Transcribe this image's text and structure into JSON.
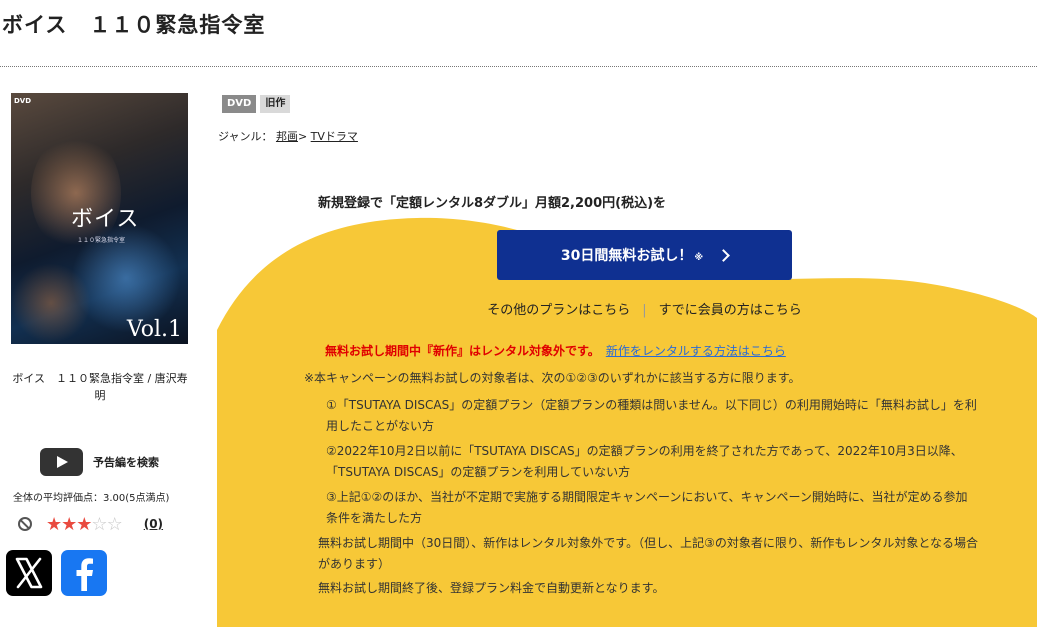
{
  "title": "ボイス　１１０緊急指令室",
  "cover": {
    "dvd_mark": "DVD",
    "title": "ボイス",
    "subtitle": "１１０緊急指令室",
    "vol": "Vol.1"
  },
  "product_name": "ボイス　１１０緊急指令室 / 唐沢寿明",
  "trailer_label": "予告編を検索",
  "average_rating_label": "全体の平均評価点：",
  "average_rating_value": "3.00(5点満点)",
  "rating": {
    "value": 3,
    "max": 5,
    "count_label": "(0)"
  },
  "badges": {
    "format": "DVD",
    "category": "旧作"
  },
  "genre": {
    "label": "ジャンル：",
    "items": [
      "邦画",
      "TVドラマ"
    ],
    "separator": ">"
  },
  "promo": {
    "headline": "新規登録で「定額レンタル8ダブル」月額2,200円(税込)を",
    "cta_label": "30日間無料お試し！",
    "cta_note": "※",
    "other_plans": "その他のプランはこちら",
    "member_link": "すでに会員の方はこちら"
  },
  "notice": {
    "warning": "無料お試し期間中『新作』はレンタル対象外です。",
    "link": "新作をレンタルする方法はこちら"
  },
  "terms": {
    "intro": "※本キャンペーンの無料お試しの対象者は、次の①②③のいずれかに該当する方に限ります。",
    "item1_line1": "①「TSUTAYA DISCAS」の定額プラン（定額プランの種類は問いません。以下同じ）の利用開始時に「無料お試し」を利",
    "item1_line2": "用したことがない方",
    "item2_line1": "②2022年10月2日以前に「TSUTAYA DISCAS」の定額プランの利用を終了された方であって、2022年10月3日以降、",
    "item2_line2": "「TSUTAYA DISCAS」の定額プランを利用していない方",
    "item3_line1": "③上記①②のほか、当社が不定期で実施する期間限定キャンペーンにおいて、キャンペーン開始時に、当社が定める参加",
    "item3_line2": "条件を満たした方",
    "note1_line1": "無料お試し期間中（30日間）、新作はレンタル対象外です。（但し、上記③の対象者に限り、新作もレンタル対象となる場合",
    "note1_line2": "があります）",
    "note2": "無料お試し期間終了後、登録プラン料金で自動更新となります。"
  },
  "colors": {
    "yellow": "#f7c837",
    "button": "#0f3091",
    "star": "#e94a3f",
    "warning": "#e00000",
    "link": "#2b6bd6"
  }
}
